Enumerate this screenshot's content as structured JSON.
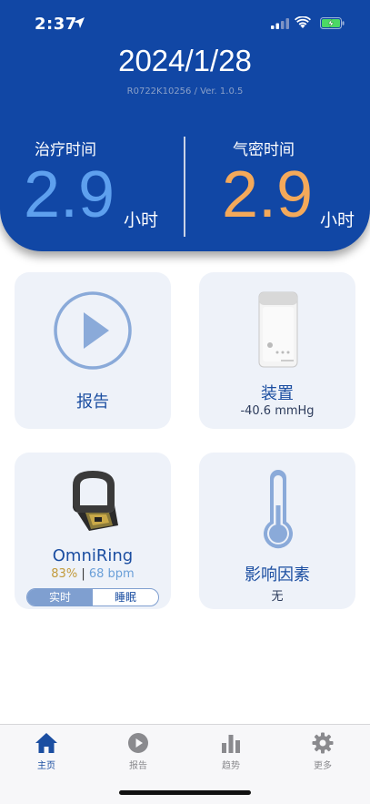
{
  "status_bar": {
    "time": "2:37"
  },
  "header": {
    "date": "2024/1/28",
    "version": "R0722K10256 / Ver. 1.0.5",
    "treatment": {
      "label": "治疗时间",
      "value": "2.9",
      "unit": "小时",
      "color": "#5ea0ee"
    },
    "seal": {
      "label": "气密时间",
      "value": "2.9",
      "unit": "小时",
      "color": "#f4a95a"
    }
  },
  "cards": {
    "report": {
      "title": "报告"
    },
    "device": {
      "title": "装置",
      "pressure": "-40.6 mmHg"
    },
    "ring": {
      "title": "OmniRing",
      "percent": "83%",
      "separator": "|",
      "bpm": "68 bpm",
      "tab_realtime": "实时",
      "tab_sleep": "睡眠"
    },
    "factors": {
      "title": "影响因素",
      "value": "无"
    }
  },
  "tabbar": {
    "home": "主页",
    "report": "报告",
    "trend": "趋势",
    "more": "更多"
  },
  "colors": {
    "brand": "#1147a5",
    "accent": "#1b4ea1"
  }
}
